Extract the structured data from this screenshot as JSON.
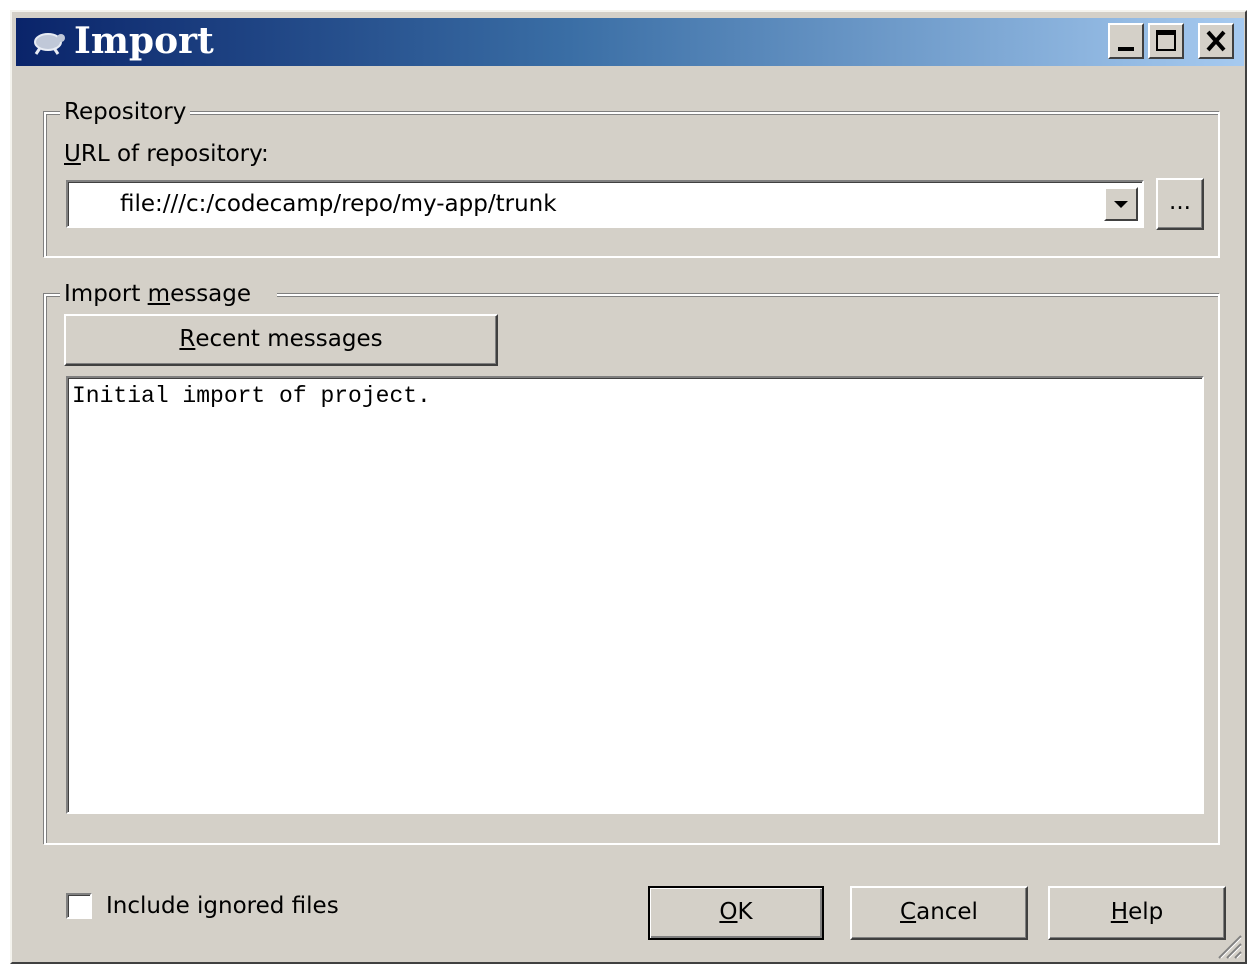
{
  "window": {
    "title": "Import",
    "icon": "tortoise-icon",
    "controls": {
      "minimize": "minimize-icon",
      "maximize": "maximize-icon",
      "close": "close-icon"
    }
  },
  "repository": {
    "legend": "Repository",
    "url_label_mnemonic": "U",
    "url_label_rest": "RL of repository:",
    "url_value": "file:///c:/codecamp/repo/my-app/trunk",
    "browse_label": "..."
  },
  "message": {
    "legend_before": "Import ",
    "legend_mnemonic": "m",
    "legend_after": "essage",
    "recent_mnemonic": "R",
    "recent_rest": "ecent messages",
    "text": "Initial import of project."
  },
  "footer": {
    "include_ignored_label": "Include ignored files",
    "include_ignored_checked": false,
    "ok_mnemonic": "O",
    "ok_rest": "K",
    "cancel_mnemonic": "C",
    "cancel_rest": "ancel",
    "help_mnemonic": "H",
    "help_rest": "elp"
  },
  "colors": {
    "title_gradient_start": "#0a246a",
    "title_gradient_end": "#a6caf0",
    "face": "#d4d0c8"
  }
}
